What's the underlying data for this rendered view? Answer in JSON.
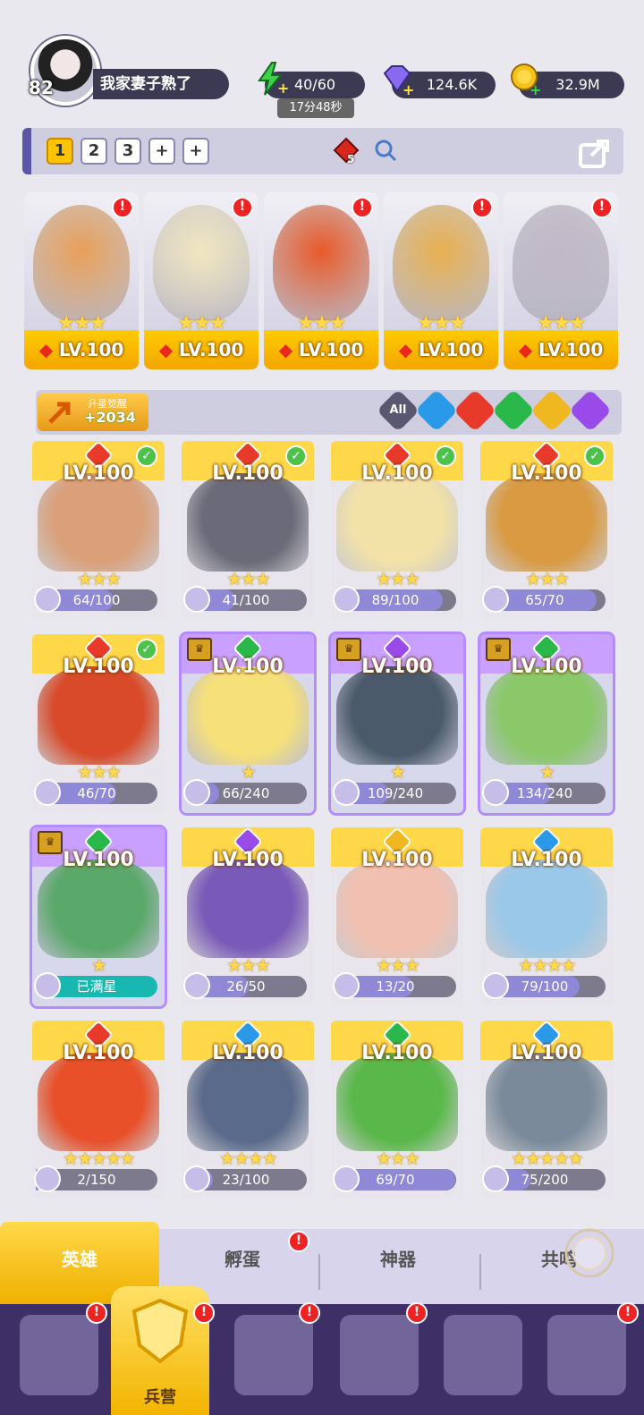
{
  "player": {
    "level": "82",
    "name": "我家妻子熟了"
  },
  "resources": {
    "energy": {
      "value": "40/60",
      "timer": "17分48秒",
      "icon": "lightning-icon",
      "color": "#3cd24a"
    },
    "gems": {
      "value": "124.6K",
      "icon": "diamond-icon",
      "color": "#8a6bf0"
    },
    "gold": {
      "value": "32.9M",
      "icon": "coin-icon",
      "color": "#f5c21a"
    }
  },
  "team_tabs": {
    "tabs": [
      "1",
      "2",
      "3",
      "+",
      "+"
    ],
    "active": "1",
    "gem_count": "5"
  },
  "lineup": [
    {
      "level": "LV.100",
      "stars": "★★★",
      "color": "#e8a05a"
    },
    {
      "level": "LV.100",
      "stars": "★★★",
      "color": "#f2e6c0"
    },
    {
      "level": "LV.100",
      "stars": "★★★",
      "color": "#e85a2a"
    },
    {
      "level": "LV.100",
      "stars": "★★★",
      "color": "#e8b050"
    },
    {
      "level": "LV.100",
      "stars": "★★★",
      "color": "#c0b8c8"
    }
  ],
  "awaken": {
    "label": "升星觉醒",
    "value": "+2034"
  },
  "filters": [
    {
      "label": "All",
      "color": "#5a5870"
    },
    {
      "label": "",
      "color": "#2a9ae8"
    },
    {
      "label": "",
      "color": "#e83a2a"
    },
    {
      "label": "",
      "color": "#2ab84a"
    },
    {
      "label": "",
      "color": "#f0b820"
    },
    {
      "label": "",
      "color": "#9a4ae8"
    }
  ],
  "heroes": [
    {
      "level": "LV.100",
      "progress": "64/100",
      "fill": 0.64,
      "stars": "★★★",
      "elem": "#e83a2a",
      "frame": "gold",
      "check": true,
      "crown": false,
      "art": "#d9a07a"
    },
    {
      "level": "LV.100",
      "progress": "41/100",
      "fill": 0.41,
      "stars": "★★★",
      "elem": "#e83a2a",
      "frame": "gold",
      "check": true,
      "crown": false,
      "art": "#6a6a78"
    },
    {
      "level": "LV.100",
      "progress": "89/100",
      "fill": 0.89,
      "stars": "★★★",
      "elem": "#e83a2a",
      "frame": "gold",
      "check": true,
      "crown": false,
      "art": "#f2e2a8"
    },
    {
      "level": "LV.100",
      "progress": "65/70",
      "fill": 0.93,
      "stars": "★★★",
      "elem": "#e83a2a",
      "frame": "gold",
      "check": true,
      "crown": false,
      "art": "#d99a42"
    },
    {
      "level": "LV.100",
      "progress": "46/70",
      "fill": 0.66,
      "stars": "★★★",
      "elem": "#e83a2a",
      "frame": "gold",
      "check": true,
      "crown": false,
      "art": "#d84a2a"
    },
    {
      "level": "LV.100",
      "progress": "66/240",
      "fill": 0.28,
      "stars": "★",
      "elem": "#2ab84a",
      "frame": "purple",
      "check": false,
      "crown": true,
      "art": "#f5e07a"
    },
    {
      "level": "LV.100",
      "progress": "109/240",
      "fill": 0.45,
      "stars": "★",
      "elem": "#9a4ae8",
      "frame": "purple",
      "check": false,
      "crown": true,
      "art": "#4a5a6a"
    },
    {
      "level": "LV.100",
      "progress": "134/240",
      "fill": 0.56,
      "stars": "★",
      "elem": "#2ab84a",
      "frame": "purple",
      "check": false,
      "crown": true,
      "art": "#8ac86a"
    },
    {
      "level": "LV.100",
      "progress": "已满星",
      "fill": 1.0,
      "stars": "★",
      "elem": "#2ab84a",
      "frame": "purple",
      "check": false,
      "crown": true,
      "art": "#5aa86a",
      "maxed": true
    },
    {
      "level": "LV.100",
      "progress": "26/50",
      "fill": 0.52,
      "stars": "★★★",
      "elem": "#9a4ae8",
      "frame": "gold",
      "check": false,
      "crown": false,
      "art": "#7a5ab8"
    },
    {
      "level": "LV.100",
      "progress": "13/20",
      "fill": 0.65,
      "stars": "★★★",
      "elem": "#f0b820",
      "frame": "gold",
      "check": false,
      "crown": false,
      "art": "#f2c0b0"
    },
    {
      "level": "LV.100",
      "progress": "79/100",
      "fill": 0.79,
      "stars": "★★★★",
      "elem": "#2a9ae8",
      "frame": "gold",
      "check": false,
      "crown": false,
      "art": "#9ac8e8"
    },
    {
      "level": "LV.100",
      "progress": "2/150",
      "fill": 0.02,
      "stars": "★★★★★",
      "elem": "#e83a2a",
      "frame": "gold",
      "check": false,
      "crown": false,
      "art": "#e8502a"
    },
    {
      "level": "LV.100",
      "progress": "23/100",
      "fill": 0.23,
      "stars": "★★★★",
      "elem": "#2a9ae8",
      "frame": "gold",
      "check": false,
      "crown": false,
      "art": "#5a6a8a"
    },
    {
      "level": "LV.100",
      "progress": "69/70",
      "fill": 0.99,
      "stars": "★★★",
      "elem": "#2ab84a",
      "frame": "gold",
      "check": false,
      "crown": false,
      "art": "#5ab84a"
    },
    {
      "level": "LV.100",
      "progress": "75/200",
      "fill": 0.375,
      "stars": "★★★★★",
      "elem": "#2a9ae8",
      "frame": "gold",
      "check": false,
      "crown": false,
      "art": "#7a8a9a"
    }
  ],
  "tabs": {
    "hero": "英雄",
    "hatch": "孵蛋",
    "artifact": "神器",
    "resonance": "共鸣"
  },
  "bottom_nav": {
    "barracks": "兵营"
  }
}
